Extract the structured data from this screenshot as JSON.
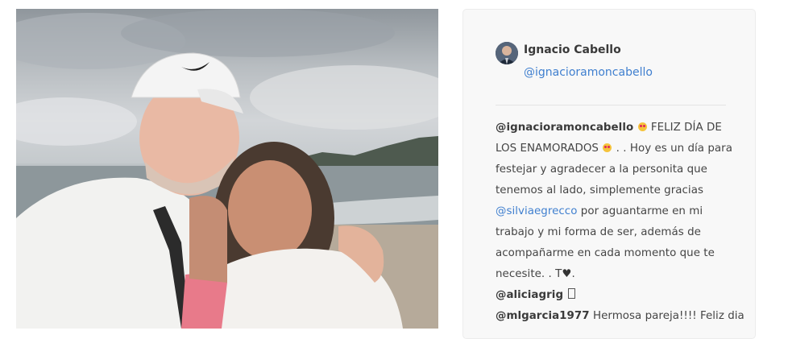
{
  "post": {
    "author": {
      "name": "Ignacio Cabello",
      "handle": "@ignacioramoncabello"
    },
    "caption": {
      "username": "@ignacioramoncabello",
      "line1_text": "FELIZ DÍA DE",
      "line2_text": "LOS ENAMORADOS",
      "line2_tail": ". . Hoy es un día para",
      "line3": "festejar y agradecer a la personita que",
      "line4": "tenemos al lado, simplemente gracias",
      "mention": "@silviaegrecco",
      "line5_tail": "por aguantarme en mi",
      "line6": "trabajo y mi forma de ser, además de",
      "line7": "acompañarme en cada momento que te",
      "line8_text": "necesite. . T",
      "heart": "♥",
      "line8_end": "."
    },
    "comments": [
      {
        "username": "@aliciagrig",
        "text": ""
      },
      {
        "username": "@mlgarcia1977",
        "text": "Hermosa pareja!!!! Feliz dia"
      }
    ]
  },
  "icons": {
    "emoji": "smiling-face-heart-eyes-icon",
    "heart": "black-heart-icon",
    "box": "missing-glyph-icon"
  }
}
